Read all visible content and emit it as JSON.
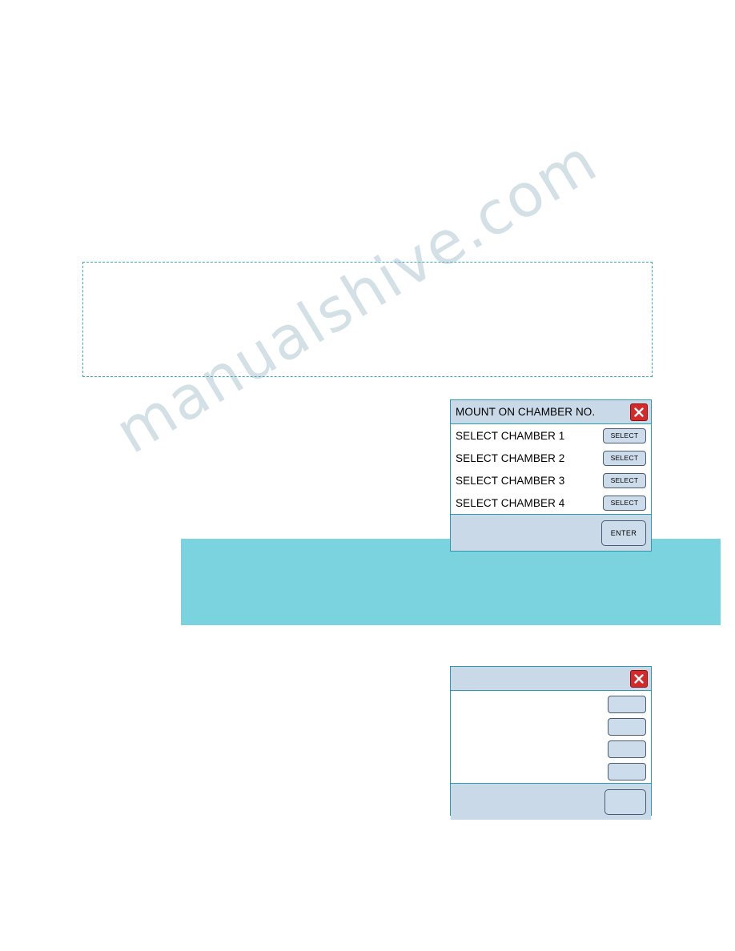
{
  "page": {
    "watermark_text": "manualshive.com"
  },
  "dialog_mount_chamber": {
    "title": "MOUNT ON CHAMBER NO.",
    "close_icon": "close-icon",
    "rows": [
      {
        "label": "SELECT CHAMBER 1",
        "button": "SELECT"
      },
      {
        "label": "SELECT CHAMBER 2",
        "button": "SELECT"
      },
      {
        "label": "SELECT CHAMBER 3",
        "button": "SELECT"
      },
      {
        "label": "SELECT CHAMBER 4",
        "button": "SELECT"
      }
    ],
    "footer_button": "ENTER"
  },
  "dialog_blank": {
    "title": "",
    "close_icon": "close-icon",
    "rows": [
      {
        "label": "",
        "button": ""
      },
      {
        "label": "",
        "button": ""
      },
      {
        "label": "",
        "button": ""
      },
      {
        "label": "",
        "button": ""
      }
    ],
    "footer_button": ""
  }
}
